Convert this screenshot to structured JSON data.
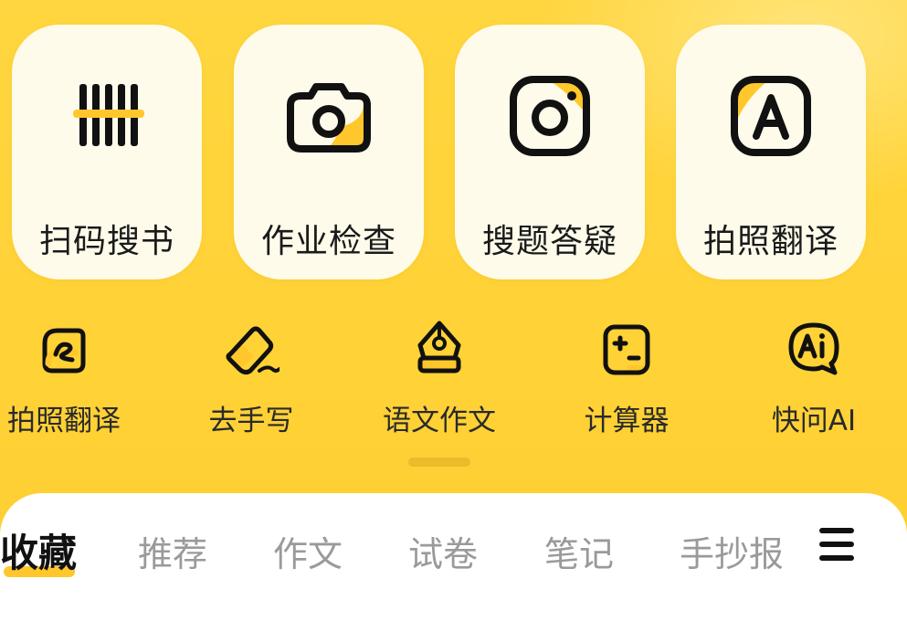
{
  "colors": {
    "background": "#FFD33D",
    "card": "#FFFBEA",
    "accent": "#FFC72C",
    "ink": "#111111"
  },
  "big_tools": [
    {
      "label": "扫码搜书",
      "icon": "barcode-scan-icon"
    },
    {
      "label": "作业检查",
      "icon": "camera-icon"
    },
    {
      "label": "搜题答疑",
      "icon": "lens-camera-icon"
    },
    {
      "label": "拍照翻译",
      "icon": "translate-a-icon"
    }
  ],
  "small_tools": [
    {
      "label": "拍照翻译",
      "icon": "photo-translate-icon"
    },
    {
      "label": "去手写",
      "icon": "eraser-icon"
    },
    {
      "label": "语文作文",
      "icon": "pen-nib-icon"
    },
    {
      "label": "计算器",
      "icon": "calculator-icon"
    },
    {
      "label": "快问AI",
      "icon": "ai-chat-icon"
    }
  ],
  "tabs": {
    "active": "收藏",
    "items": [
      "推荐",
      "作文",
      "试卷",
      "笔记",
      "手抄报"
    ],
    "menu_icon": "menu-icon"
  }
}
